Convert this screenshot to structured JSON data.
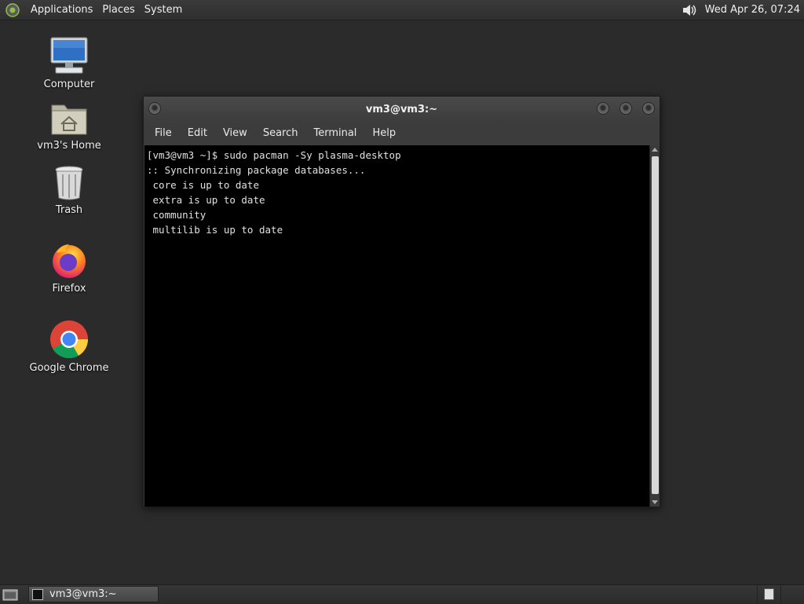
{
  "top_panel": {
    "menus": [
      "Applications",
      "Places",
      "System"
    ],
    "clock": "Wed Apr 26, 07:24",
    "volume_icon": "volume-icon"
  },
  "desktop": {
    "icons": [
      {
        "label": "Computer",
        "icon": "computer-icon"
      },
      {
        "label": "vm3's Home",
        "icon": "home-folder-icon"
      },
      {
        "label": "Trash",
        "icon": "trash-icon"
      },
      {
        "label": "Firefox",
        "icon": "firefox-icon"
      },
      {
        "label": "Google Chrome",
        "icon": "chrome-icon"
      }
    ]
  },
  "terminal": {
    "title": "vm3@vm3:~",
    "menu": [
      "File",
      "Edit",
      "View",
      "Search",
      "Terminal",
      "Help"
    ],
    "lines": [
      "[vm3@vm3 ~]$ sudo pacman -Sy plasma-desktop",
      ":: Synchronizing package databases...",
      " core is up to date",
      " extra is up to date",
      " community",
      " multilib is up to date"
    ]
  },
  "bottom_panel": {
    "task_label": "vm3@vm3:~"
  }
}
